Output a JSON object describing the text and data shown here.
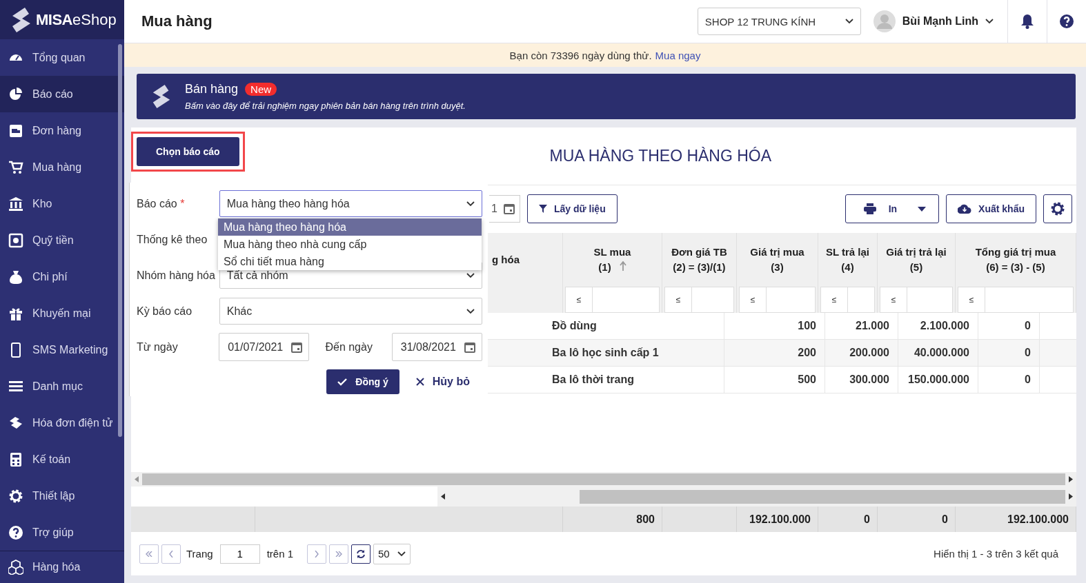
{
  "logo": {
    "brand": "MISA",
    "product": "eShop"
  },
  "sidebar": {
    "items": [
      {
        "label": "Tổng quan",
        "selected": false
      },
      {
        "label": "Báo cáo",
        "selected": true
      },
      {
        "label": "Đơn hàng",
        "selected": false
      },
      {
        "label": "Mua hàng",
        "selected": false
      },
      {
        "label": "Kho",
        "selected": false
      },
      {
        "label": "Quỹ tiền",
        "selected": false
      },
      {
        "label": "Chi phí",
        "selected": false
      },
      {
        "label": "Khuyến mại",
        "selected": false
      },
      {
        "label": "SMS Marketing",
        "selected": false
      },
      {
        "label": "Danh mục",
        "selected": false
      },
      {
        "label": "Hóa đơn điện tử",
        "selected": false
      },
      {
        "label": "Kế toán",
        "selected": false
      },
      {
        "label": "Thiết lập",
        "selected": false
      },
      {
        "label": "Trợ giúp",
        "selected": false
      }
    ],
    "bottom_item": {
      "label": "Hàng hóa"
    }
  },
  "header": {
    "title": "Mua hàng",
    "store": "SHOP 12 TRUNG KÍNH",
    "user": "Bùi Mạnh Linh"
  },
  "trial_banner": {
    "text": "Bạn còn 73396 ngày dùng thử.",
    "link": "Mua ngay"
  },
  "promo": {
    "title": "Bán hàng",
    "badge": "New",
    "subtitle": "Bấm vào đây để trải nghiệm ngay phiên bản bán hàng trên trình duyệt."
  },
  "report": {
    "choose_button": "Chọn báo cáo",
    "title": "MUA HÀNG THEO HÀNG HÓA"
  },
  "form": {
    "report": {
      "label": "Báo cáo",
      "required_mark": "*",
      "value": "Mua hàng theo hàng hóa",
      "expanded": true,
      "options": [
        {
          "label": "Mua hàng theo hàng hóa",
          "selected": true
        },
        {
          "label": "Mua hàng theo nhà cung cấp",
          "selected": false
        },
        {
          "label": "Sổ chi tiết mua hàng",
          "selected": false
        }
      ]
    },
    "group_by": {
      "label": "Thống kê theo"
    },
    "product_group": {
      "label": "Nhóm hàng hóa",
      "value": "Tất cả nhóm"
    },
    "period": {
      "label": "Kỳ báo cáo",
      "value": "Khác"
    },
    "from": {
      "label": "Từ ngày",
      "value": "01/07/2021"
    },
    "to": {
      "label": "Đến ngày",
      "value": "31/08/2021"
    },
    "ok_button": "Đồng ý",
    "cancel_button": "Hủy bỏ"
  },
  "toolbar": {
    "date_fragment": "1",
    "fetch_button": "Lấy dữ liệu",
    "print_button": "In",
    "export_button": "Xuất khẩu"
  },
  "table_header": {
    "columns": [
      {
        "label": "g hóa"
      },
      {
        "label": "SL mua",
        "sub": "(1)",
        "sorted": true,
        "filter": "≤"
      },
      {
        "label": "Đơn giá TB",
        "sub": "(2) = (3)/(1)",
        "sorted": false,
        "filter": "≤"
      },
      {
        "label": "Giá trị mua",
        "sub": "(3)",
        "sorted": false,
        "filter": "≤"
      },
      {
        "label": "SL trả lại",
        "sub": "(4)",
        "sorted": false,
        "filter": "≤"
      },
      {
        "label": "Giá trị trả lại",
        "sub": "(5)",
        "sorted": false,
        "filter": "≤"
      },
      {
        "label": "Tổng giá trị mua",
        "sub": "(6) = (3) - (5)",
        "sorted": false,
        "filter": "≤"
      }
    ]
  },
  "table": {
    "rows": [
      {
        "cells": [
          "Đồ dùng",
          "100",
          "21.000",
          "2.100.000",
          "0"
        ]
      },
      {
        "cells": [
          "Ba lô học sinh cấp 1",
          "200",
          "200.000",
          "40.000.000",
          "0"
        ]
      },
      {
        "cells": [
          "Ba lô thời trang",
          "500",
          "300.000",
          "150.000.000",
          "0"
        ]
      }
    ],
    "totals": {
      "sl_mua": "800",
      "gia_tri_mua": "192.100.000",
      "sl_tra_lai": "0",
      "gia_tri_tra_lai": "0",
      "tong_gia_tri_mua": "192.100.000"
    }
  },
  "pagination": {
    "page_label": "Trang",
    "page": "1",
    "of": "trên 1",
    "page_size": "50",
    "summary": "Hiển thị 1 - 3 trên 3 kết quả"
  }
}
